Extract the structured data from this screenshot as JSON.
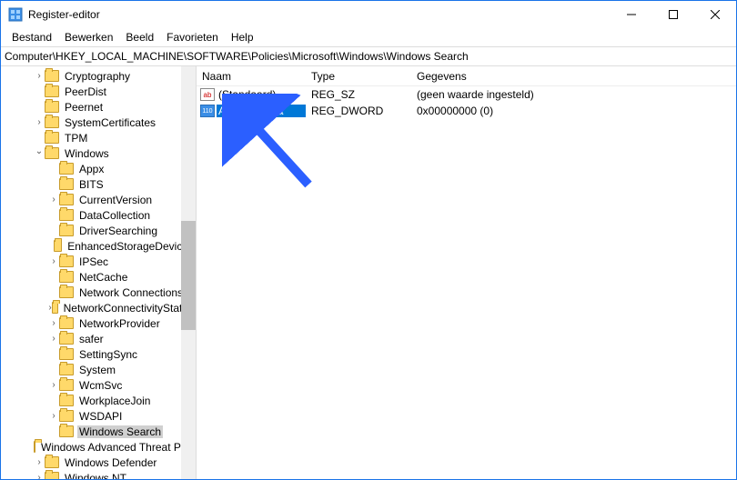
{
  "window": {
    "title": "Register-editor"
  },
  "menu": {
    "items": [
      "Bestand",
      "Bewerken",
      "Beeld",
      "Favorieten",
      "Help"
    ]
  },
  "address": {
    "path": "Computer\\HKEY_LOCAL_MACHINE\\SOFTWARE\\Policies\\Microsoft\\Windows\\Windows Search"
  },
  "tree": {
    "nodes": [
      {
        "label": "Cryptography",
        "indent": 2,
        "expander": ">"
      },
      {
        "label": "PeerDist",
        "indent": 2,
        "expander": ""
      },
      {
        "label": "Peernet",
        "indent": 2,
        "expander": ""
      },
      {
        "label": "SystemCertificates",
        "indent": 2,
        "expander": ">"
      },
      {
        "label": "TPM",
        "indent": 2,
        "expander": ""
      },
      {
        "label": "Windows",
        "indent": 2,
        "expander": "v"
      },
      {
        "label": "Appx",
        "indent": 3,
        "expander": ""
      },
      {
        "label": "BITS",
        "indent": 3,
        "expander": ""
      },
      {
        "label": "CurrentVersion",
        "indent": 3,
        "expander": ">"
      },
      {
        "label": "DataCollection",
        "indent": 3,
        "expander": ""
      },
      {
        "label": "DriverSearching",
        "indent": 3,
        "expander": ""
      },
      {
        "label": "EnhancedStorageDevices",
        "indent": 3,
        "expander": ""
      },
      {
        "label": "IPSec",
        "indent": 3,
        "expander": ">"
      },
      {
        "label": "NetCache",
        "indent": 3,
        "expander": ""
      },
      {
        "label": "Network Connections",
        "indent": 3,
        "expander": ""
      },
      {
        "label": "NetworkConnectivityStatus",
        "indent": 3,
        "expander": ">"
      },
      {
        "label": "NetworkProvider",
        "indent": 3,
        "expander": ">"
      },
      {
        "label": "safer",
        "indent": 3,
        "expander": ">"
      },
      {
        "label": "SettingSync",
        "indent": 3,
        "expander": ""
      },
      {
        "label": "System",
        "indent": 3,
        "expander": ""
      },
      {
        "label": "WcmSvc",
        "indent": 3,
        "expander": ">"
      },
      {
        "label": "WorkplaceJoin",
        "indent": 3,
        "expander": ""
      },
      {
        "label": "WSDAPI",
        "indent": 3,
        "expander": ">"
      },
      {
        "label": "Windows Search",
        "indent": 3,
        "expander": "",
        "selected": true
      },
      {
        "label": "Windows Advanced Threat Protection",
        "indent": 2,
        "expander": ""
      },
      {
        "label": "Windows Defender",
        "indent": 2,
        "expander": ">"
      },
      {
        "label": "Windows NT",
        "indent": 2,
        "expander": ">"
      }
    ]
  },
  "list": {
    "headers": {
      "name": "Naam",
      "type": "Type",
      "data": "Gegevens"
    },
    "rows": [
      {
        "icon": "str",
        "icon_text": "ab",
        "name": "(Standaard)",
        "type": "REG_SZ",
        "data": "(geen waarde ingesteld)",
        "selected": false
      },
      {
        "icon": "dword",
        "icon_text": "110",
        "name": "AllowCortana",
        "type": "REG_DWORD",
        "data": "0x00000000 (0)",
        "selected": true
      }
    ]
  }
}
